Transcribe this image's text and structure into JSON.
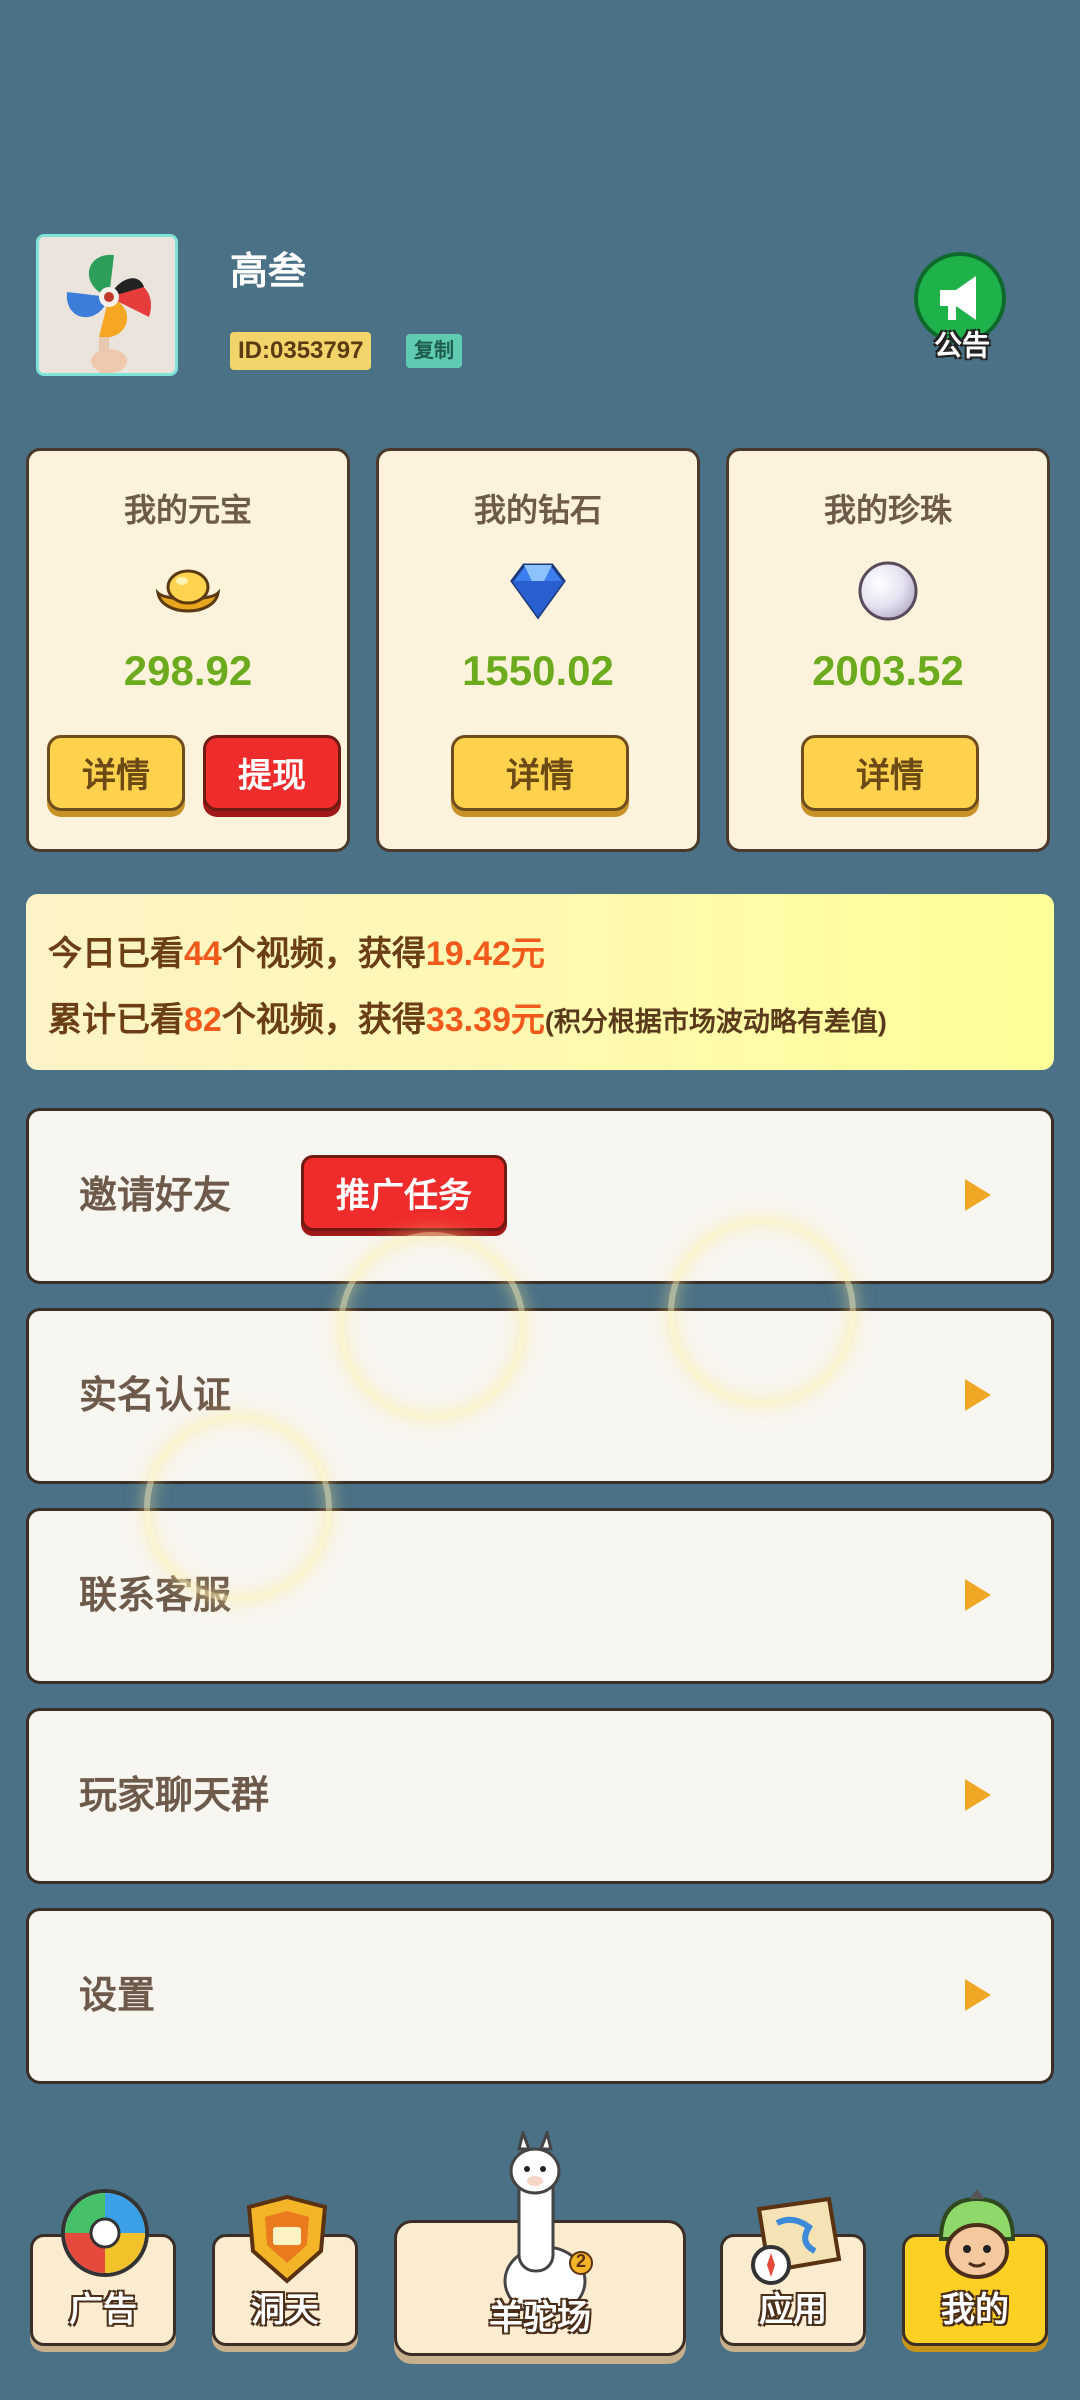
{
  "profile": {
    "username": "高叁",
    "user_id": "ID:0353797",
    "copy_label": "复制",
    "notice_label": "公告"
  },
  "cards": [
    {
      "title": "我的元宝",
      "value": "298.92",
      "icon": "gold-ingot-icon",
      "detail_label": "详情",
      "withdraw_label": "提现"
    },
    {
      "title": "我的钻石",
      "value": "1550.02",
      "icon": "diamond-icon",
      "detail_label": "详情"
    },
    {
      "title": "我的珍珠",
      "value": "2003.52",
      "icon": "pearl-icon",
      "detail_label": "详情"
    }
  ],
  "stats": {
    "today_prefix": "今日已看",
    "today_count": "44",
    "today_mid": "个视频，获得",
    "today_amount": "19.42元",
    "total_prefix": "累计已看",
    "total_count": "82",
    "total_mid": "个视频，获得",
    "total_amount": "33.39元",
    "total_note": "(积分根据市场波动略有差值)"
  },
  "menu": [
    {
      "label": "邀请好友",
      "badge": "推广任务"
    },
    {
      "label": "实名认证"
    },
    {
      "label": "联系客服"
    },
    {
      "label": "玩家聊天群"
    },
    {
      "label": "设置"
    }
  ],
  "nav": [
    {
      "label": "广告",
      "icon": "color-wheel-icon"
    },
    {
      "label": "洞天",
      "icon": "shield-badge-icon"
    },
    {
      "label": "羊驼场",
      "icon": "alpaca-icon",
      "badge": "2"
    },
    {
      "label": "应用",
      "icon": "map-compass-icon"
    },
    {
      "label": "我的",
      "icon": "character-avatar-icon",
      "active": true
    }
  ],
  "colors": {
    "background": "#4a7186",
    "value_green": "#6cab1e",
    "highlight_orange": "#f25a1b",
    "button_yellow": "#ffd24d",
    "button_red": "#ee2c2c"
  }
}
